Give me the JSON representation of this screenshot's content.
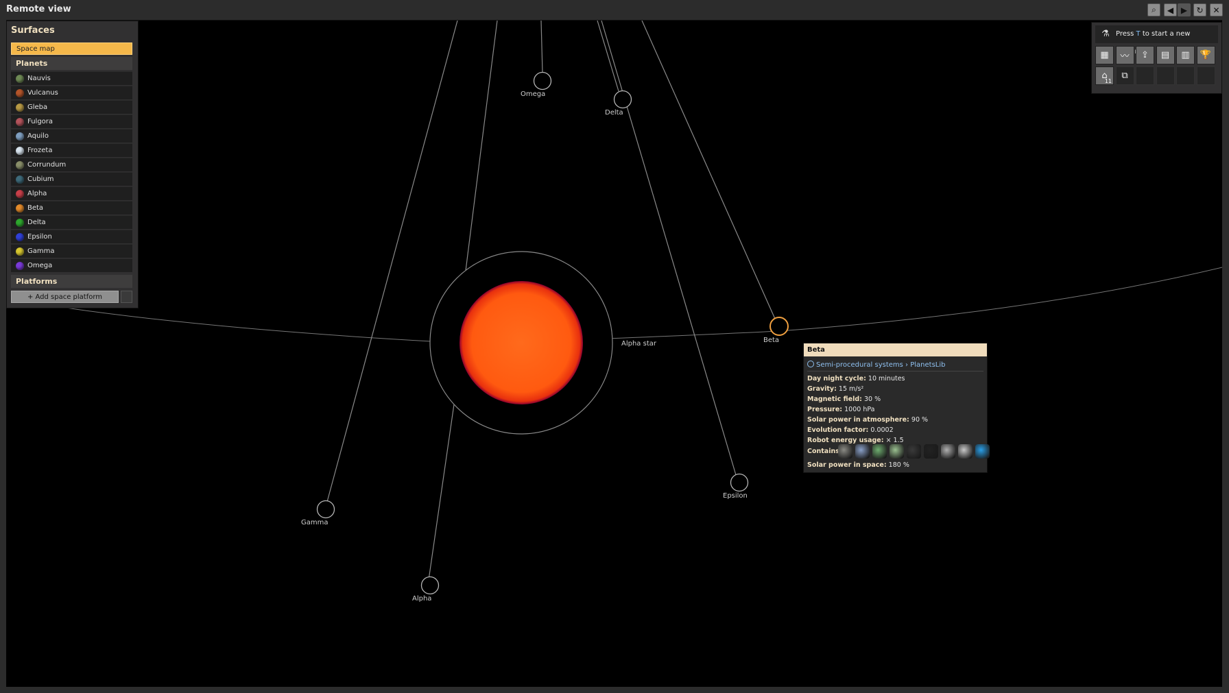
{
  "window": {
    "title": "Remote view",
    "buttons": [
      {
        "name": "search-icon",
        "glyph": "⌕"
      },
      {
        "name": "back-arrow-icon",
        "glyph": "◀"
      },
      {
        "name": "forward-arrow-icon",
        "glyph": "▶"
      },
      {
        "name": "refresh-icon",
        "glyph": "↻"
      },
      {
        "name": "close-icon",
        "glyph": "✕"
      }
    ]
  },
  "surfaces": {
    "title": "Surfaces",
    "space_map": "Space map",
    "planets_header": "Planets",
    "planets": [
      {
        "label": "Nauvis",
        "color": "#6f8a55"
      },
      {
        "label": "Vulcanus",
        "color": "#b4552a"
      },
      {
        "label": "Gleba",
        "color": "#b89a45"
      },
      {
        "label": "Fulgora",
        "color": "#b4545c"
      },
      {
        "label": "Aquilo",
        "color": "#7f9fc0"
      },
      {
        "label": "Frozeta",
        "color": "#d8e4ee"
      },
      {
        "label": "Corrundum",
        "color": "#8a8f6a"
      },
      {
        "label": "Cubium",
        "color": "#3e6a7a"
      },
      {
        "label": "Alpha",
        "color": "#c9404a"
      },
      {
        "label": "Beta",
        "color": "#e28a2a"
      },
      {
        "label": "Delta",
        "color": "#2ea82e"
      },
      {
        "label": "Epsilon",
        "color": "#3040d8"
      },
      {
        "label": "Gamma",
        "color": "#d8c830"
      },
      {
        "label": "Omega",
        "color": "#7a3ad8"
      }
    ],
    "platforms_header": "Platforms",
    "add_platform": "+ Add space platform"
  },
  "research": {
    "prompt_prefix": "Press",
    "prompt_key": "T",
    "prompt_suffix": "to start a new research.",
    "slots_row1": [
      {
        "name": "factory-icon",
        "glyph": "▦"
      },
      {
        "name": "production-stats-icon",
        "glyph": "〰"
      },
      {
        "name": "logistics-icon",
        "glyph": "⇪"
      },
      {
        "name": "book-icon",
        "glyph": "▤"
      },
      {
        "name": "train-icon",
        "glyph": "▥"
      },
      {
        "name": "trophy-icon",
        "glyph": "🏆"
      }
    ],
    "slots_row2": [
      {
        "name": "tech-tree-icon",
        "glyph": "⌂",
        "count": "11"
      },
      {
        "name": "blueprint-icon",
        "glyph": "⧉"
      }
    ]
  },
  "map": {
    "star_label": "Alpha star",
    "bodies": [
      {
        "label": "Omega"
      },
      {
        "label": "Delta"
      },
      {
        "label": "Beta"
      },
      {
        "label": "Epsilon"
      },
      {
        "label": "Gamma"
      },
      {
        "label": "Alpha"
      }
    ],
    "selected": "Beta",
    "selected_color": "#f0a040"
  },
  "tooltip": {
    "title": "Beta",
    "source": "Semi-procedural systems › PlanetsLib",
    "properties": [
      {
        "key": "Day night cycle:",
        "value": "10 minutes"
      },
      {
        "key": "Gravity:",
        "value": "15 m/s²"
      },
      {
        "key": "Magnetic field:",
        "value": "30 %"
      },
      {
        "key": "Pressure:",
        "value": "1000 hPa"
      },
      {
        "key": "Solar power in atmosphere:",
        "value": "90 %"
      },
      {
        "key": "Evolution factor:",
        "value": "0.0002"
      },
      {
        "key": "Robot energy usage:",
        "value": "× 1.5"
      }
    ],
    "contains_label": "Contains:",
    "resources": [
      {
        "name": "stone-icon",
        "color": "#8a8a84"
      },
      {
        "name": "iron-ore-icon",
        "color": "#8aa0c8"
      },
      {
        "name": "copper-ore-icon",
        "color": "#6fae70"
      },
      {
        "name": "uranium-ore-icon",
        "color": "#9ac090"
      },
      {
        "name": "coal-icon",
        "color": "#3a3a3a"
      },
      {
        "name": "crude-oil-icon",
        "color": "#222"
      },
      {
        "name": "sulfur-icon",
        "color": "#b0b0b0"
      },
      {
        "name": "calcite-icon",
        "color": "#c8c8c8"
      },
      {
        "name": "water-icon",
        "color": "#2a9fe8"
      }
    ],
    "space_label": "Solar power in space:",
    "space_value": "180 %"
  }
}
